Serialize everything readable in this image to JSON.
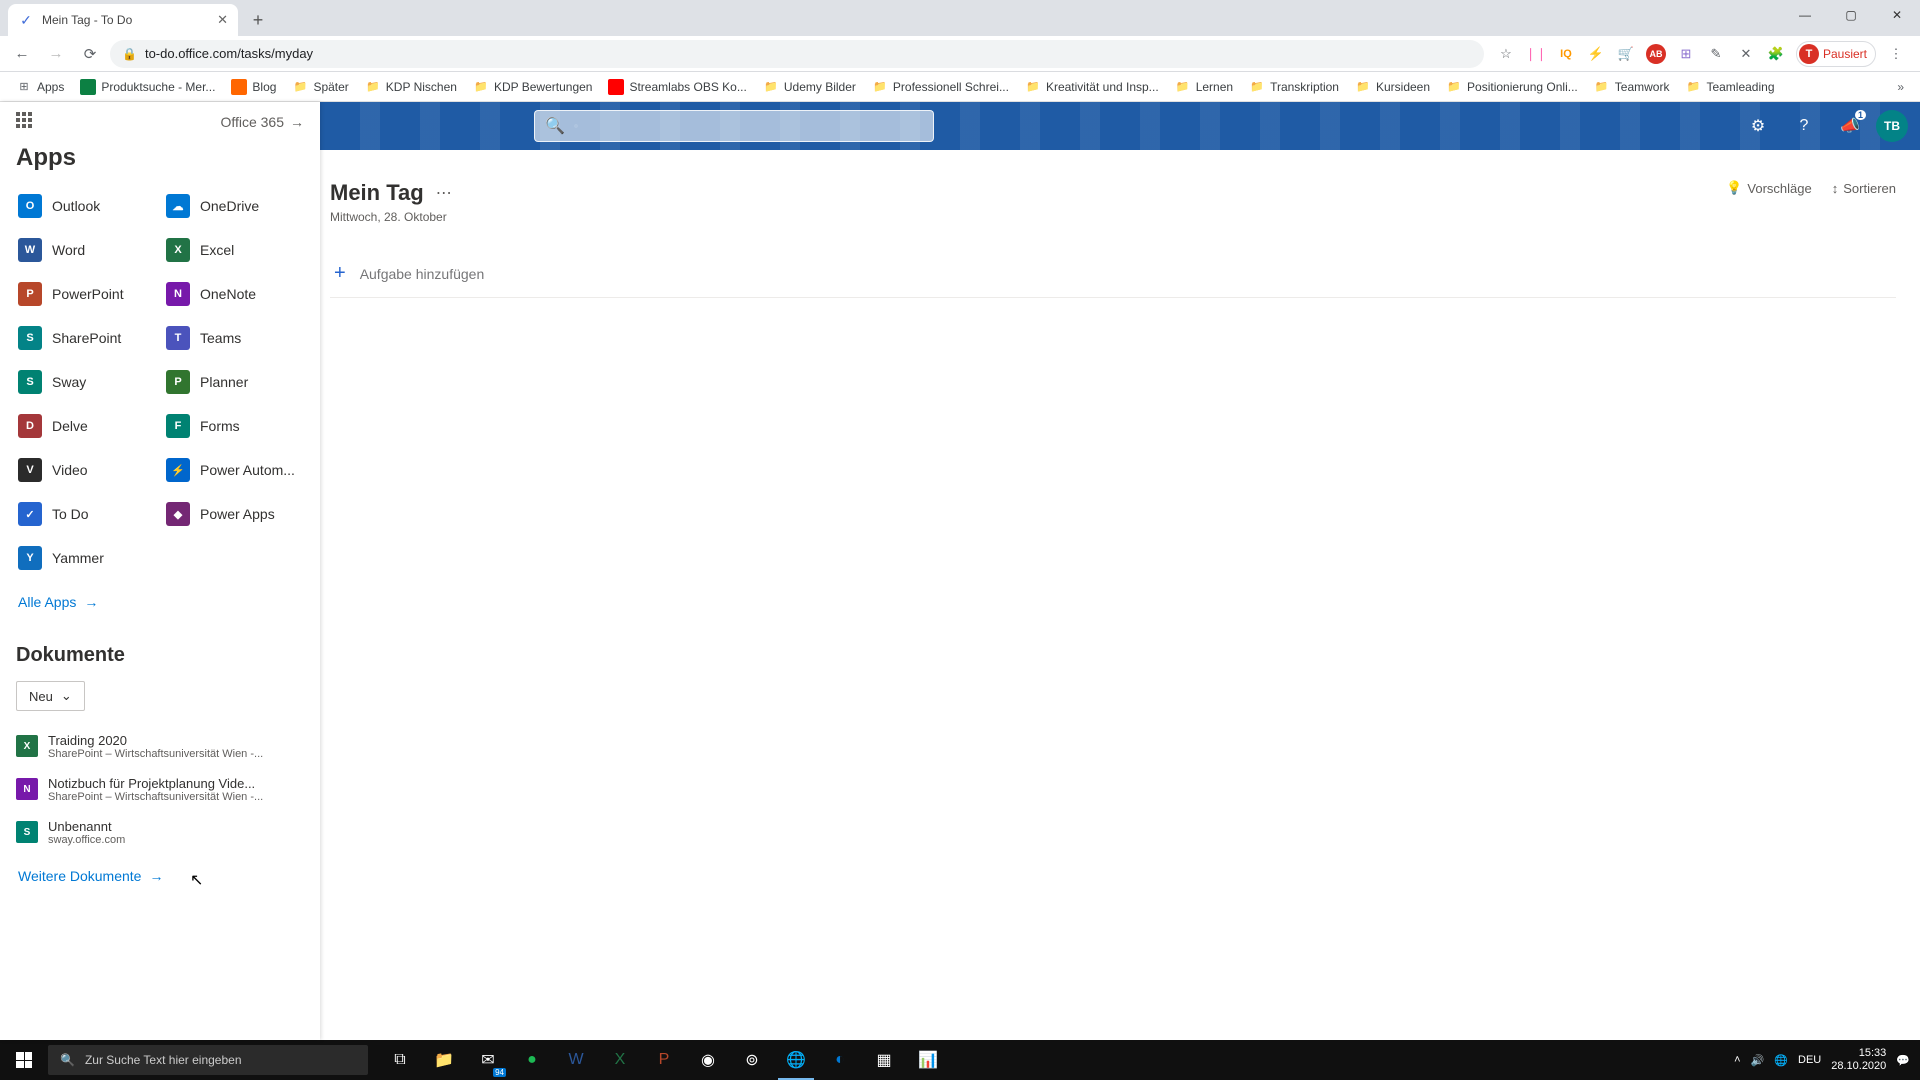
{
  "browser": {
    "tab_title": "Mein Tag - To Do",
    "url": "to-do.office.com/tasks/myday",
    "profile_label": "Pausiert",
    "profile_initial": "T"
  },
  "bookmarks": [
    {
      "label": "Apps",
      "icon": "grid"
    },
    {
      "label": "Produktsuche - Mer...",
      "icon": "green"
    },
    {
      "label": "Blog",
      "icon": "orange"
    },
    {
      "label": "Später",
      "icon": "folder"
    },
    {
      "label": "KDP Nischen",
      "icon": "folder"
    },
    {
      "label": "KDP Bewertungen",
      "icon": "folder"
    },
    {
      "label": "Streamlabs OBS Ko...",
      "icon": "yt"
    },
    {
      "label": "Udemy Bilder",
      "icon": "folder"
    },
    {
      "label": "Professionell Schrei...",
      "icon": "folder"
    },
    {
      "label": "Kreativität und Insp...",
      "icon": "folder"
    },
    {
      "label": "Lernen",
      "icon": "folder"
    },
    {
      "label": "Transkription",
      "icon": "folder"
    },
    {
      "label": "Kursideen",
      "icon": "folder"
    },
    {
      "label": "Positionierung Onli...",
      "icon": "folder"
    },
    {
      "label": "Teamwork",
      "icon": "folder"
    },
    {
      "label": "Teamleading",
      "icon": "folder"
    }
  ],
  "launcher": {
    "o365_label": "Office 365",
    "apps_title": "Apps",
    "all_apps": "Alle Apps",
    "docs_title": "Dokumente",
    "new_btn": "Neu",
    "more_docs": "Weitere Dokumente",
    "apps": [
      {
        "name": "Outlook",
        "color": "#0078d4",
        "abbr": "O"
      },
      {
        "name": "OneDrive",
        "color": "#0078d4",
        "abbr": "☁"
      },
      {
        "name": "Word",
        "color": "#2b579a",
        "abbr": "W"
      },
      {
        "name": "Excel",
        "color": "#217346",
        "abbr": "X"
      },
      {
        "name": "PowerPoint",
        "color": "#b7472a",
        "abbr": "P"
      },
      {
        "name": "OneNote",
        "color": "#7719aa",
        "abbr": "N"
      },
      {
        "name": "SharePoint",
        "color": "#038387",
        "abbr": "S"
      },
      {
        "name": "Teams",
        "color": "#4b53bc",
        "abbr": "T"
      },
      {
        "name": "Sway",
        "color": "#008272",
        "abbr": "S"
      },
      {
        "name": "Planner",
        "color": "#31752f",
        "abbr": "P"
      },
      {
        "name": "Delve",
        "color": "#a4373a",
        "abbr": "D"
      },
      {
        "name": "Forms",
        "color": "#008272",
        "abbr": "F"
      },
      {
        "name": "Video",
        "color": "#2b2b2b",
        "abbr": "V"
      },
      {
        "name": "Power Autom...",
        "color": "#0066cc",
        "abbr": "⚡"
      },
      {
        "name": "To Do",
        "color": "#2564cf",
        "abbr": "✓"
      },
      {
        "name": "Power Apps",
        "color": "#742774",
        "abbr": "◆"
      },
      {
        "name": "Yammer",
        "color": "#106ebe",
        "abbr": "Y"
      }
    ],
    "docs": [
      {
        "name": "Traiding 2020",
        "loc": "SharePoint – Wirtschaftsuniversität Wien -...",
        "color": "#217346",
        "abbr": "X"
      },
      {
        "name": "Notizbuch für Projektplanung Vide...",
        "loc": "SharePoint – Wirtschaftsuniversität Wien -...",
        "color": "#7719aa",
        "abbr": "N"
      },
      {
        "name": "Unbenannt",
        "loc": "sway.office.com",
        "color": "#008272",
        "abbr": "S"
      }
    ]
  },
  "header": {
    "avatar": "TB",
    "megaphone_badge": "1"
  },
  "page": {
    "title": "Mein Tag",
    "date": "Mittwoch, 28. Oktober",
    "suggestions": "Vorschläge",
    "sort": "Sortieren",
    "add_task": "Aufgabe hinzufügen"
  },
  "taskbar": {
    "search_placeholder": "Zur Suche Text hier eingeben",
    "mail_badge": "94",
    "lang": "DEU",
    "time": "15:33",
    "date": "28.10.2020"
  }
}
